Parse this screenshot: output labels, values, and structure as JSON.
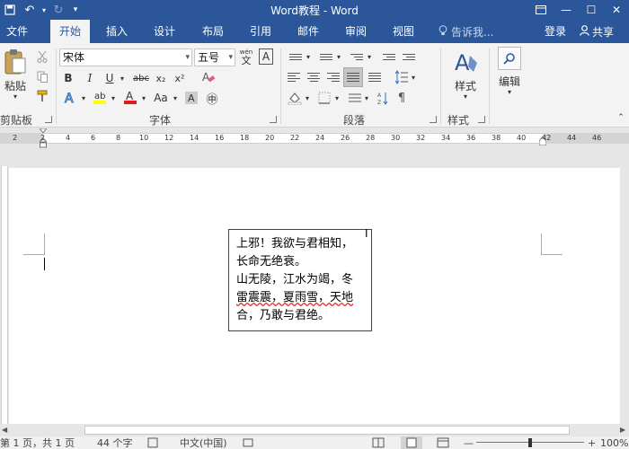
{
  "window": {
    "title": "Word教程 - Word",
    "restore_ribbon_icon": "ribbon-display-icon",
    "minimize": "—",
    "maximize": "☐",
    "close": "✕"
  },
  "quick_access": {
    "save_icon": "save-icon",
    "undo_icon": "undo-icon",
    "redo_icon": "redo-icon"
  },
  "tabs": [
    "文件",
    "开始",
    "插入",
    "设计",
    "布局",
    "引用",
    "邮件",
    "审阅",
    "视图"
  ],
  "active_tab": "开始",
  "tell_me": {
    "placeholder": "告诉我..."
  },
  "account": {
    "login": "登录",
    "share": "共享"
  },
  "ribbon": {
    "clipboard": {
      "paste_label": "粘贴",
      "group_label": "剪贴板"
    },
    "font": {
      "font_name": "宋体",
      "font_size": "五号",
      "wen_label": "wén",
      "wen_char": "文",
      "boxed_a": "A",
      "bold": "B",
      "italic": "I",
      "underline": "U",
      "strike": "abc",
      "subscript": "x₂",
      "superscript": "x²",
      "case_label": "Aa",
      "phonetic": "㊥",
      "group_label": "字体"
    },
    "paragraph": {
      "group_label": "段落"
    },
    "styles": {
      "label": "样式",
      "group_label": "样式"
    },
    "editing": {
      "label": "编辑"
    }
  },
  "ruler": {
    "numbers": [
      "2",
      "2",
      "4",
      "6",
      "8",
      "10",
      "12",
      "14",
      "16",
      "18",
      "20",
      "22",
      "24",
      "26",
      "28",
      "30",
      "32",
      "34",
      "36",
      "38",
      "40",
      "42",
      "44",
      "46"
    ]
  },
  "document": {
    "textbox_lines": [
      "上邪！我欲与君相知，",
      "长命无绝衰。",
      "山无陵，江水为竭，冬",
      "雷震震，夏雨雪，天地",
      "合，乃敢与君绝。"
    ]
  },
  "status": {
    "page": "第 1 页，共 1 页",
    "words": "44 个字",
    "language": "中文(中国)",
    "zoom": "100%"
  }
}
